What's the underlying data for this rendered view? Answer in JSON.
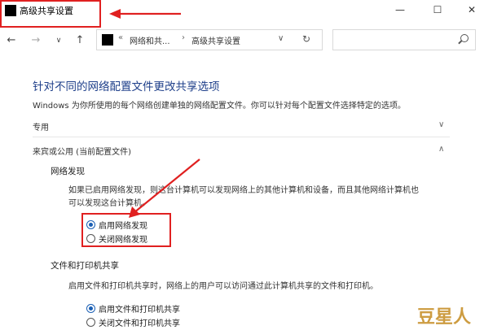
{
  "window": {
    "title": "高级共享设置",
    "minimize": "—",
    "maximize": "☐",
    "close": "✕"
  },
  "nav": {
    "back": "←",
    "forward": "→",
    "recent": "∨",
    "up": "↑"
  },
  "address": {
    "chevron": "«",
    "crumb1": "网络和共...",
    "sep": "›",
    "crumb2": "高级共享设置",
    "dropdown": "∨",
    "refresh": "↻"
  },
  "content": {
    "heading": "针对不同的网络配置文件更改共享选项",
    "description": "Windows 为你所使用的每个网络创建单独的网络配置文件。你可以针对每个配置文件选择特定的选项。",
    "private_header": "专用",
    "guest_header": "来宾或公用 (当前配置文件)",
    "network_discovery": {
      "title": "网络发现",
      "text_line1": "如果已启用网络发现，则这台计算机可以发现网络上的其他计算机和设备，而且其他网络计算机也",
      "text_line2": "可以发现这台计算机。",
      "option_on": "启用网络发现",
      "option_off": "关闭网络发现"
    },
    "file_sharing": {
      "title": "文件和打印机共享",
      "text": "启用文件和打印机共享时，网络上的用户可以访问通过此计算机共享的文件和打印机。",
      "option_on": "启用文件和打印机共享",
      "option_off": "关闭文件和打印机共享"
    }
  },
  "watermark": "豆星人",
  "colors": {
    "heading": "#1e3f8a",
    "annotation": "#e02020",
    "radio_selected": "#1a5fb4"
  }
}
